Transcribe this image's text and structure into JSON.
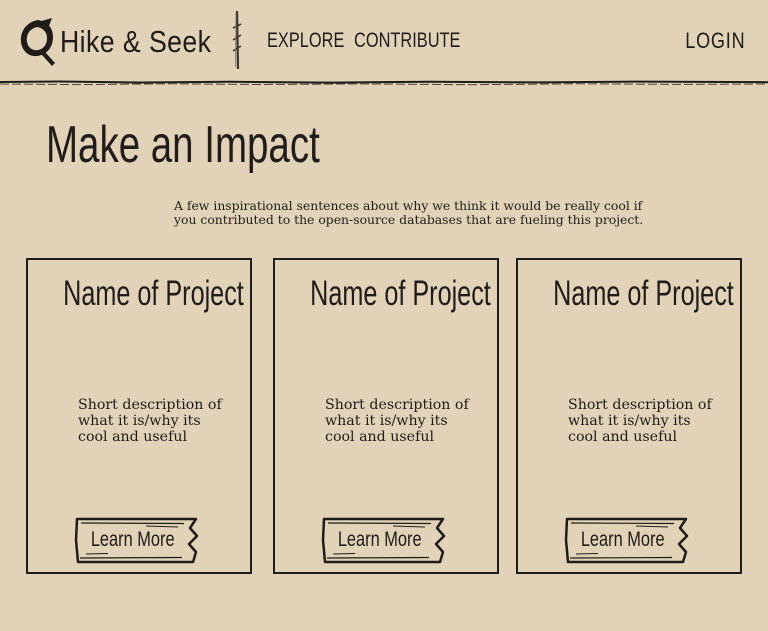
{
  "header": {
    "brand": "Hike & Seek",
    "nav": [
      {
        "label": "EXPLORE"
      },
      {
        "label": "CONTRIBUTE"
      }
    ],
    "login_label": "LOGIN"
  },
  "hero": {
    "title": "Make an Impact",
    "intro": "A few inspirational sentences about why we think it would be really cool if you contributed to the open-source databases that are fueling this project."
  },
  "cards": [
    {
      "title": "Name of Project",
      "description": "Short description of what it is/why its cool and useful",
      "button_label": "Learn More"
    },
    {
      "title": "Name of Project",
      "description": "Short description of what it is/why its cool and useful",
      "button_label": "Learn More"
    },
    {
      "title": "Name of Project",
      "description": "Short description of what it is/why its cool and useful",
      "button_label": "Learn More"
    }
  ],
  "icons": {
    "logo": "leaf-magnifier-icon",
    "divider": "stick-divider-icon"
  },
  "colors": {
    "background": "#e2d2b8",
    "ink": "#1f1c19"
  }
}
